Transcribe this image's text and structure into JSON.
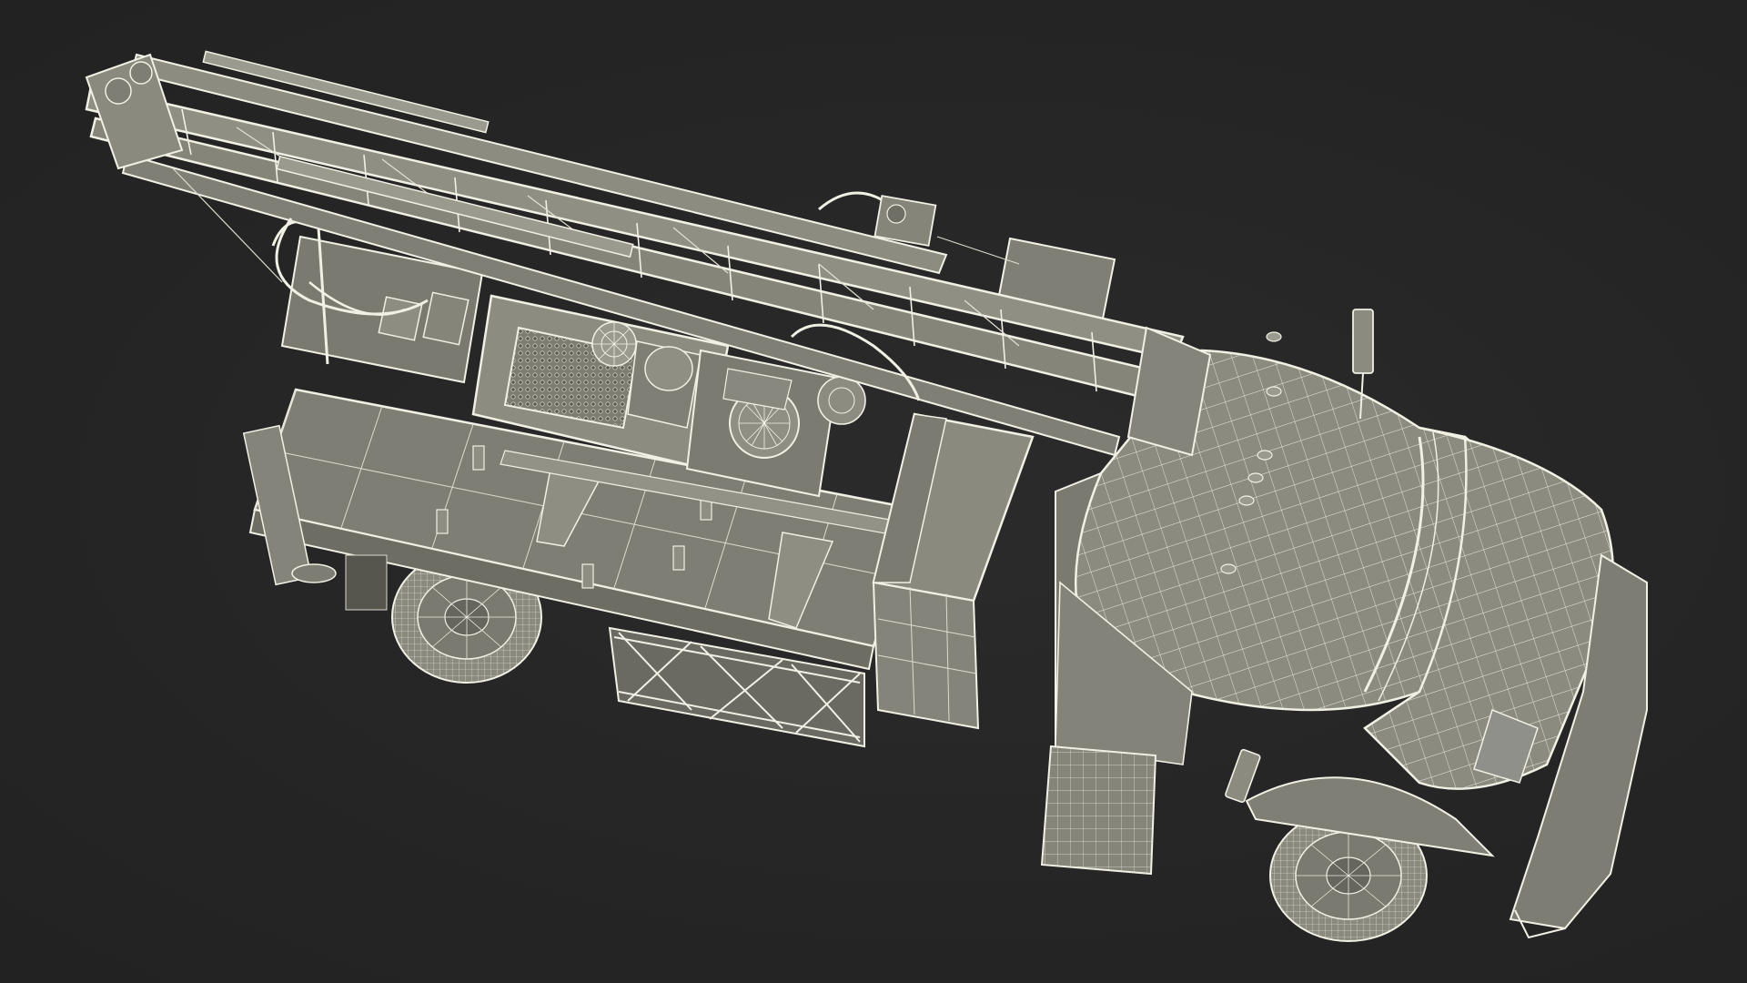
{
  "scene": {
    "subject": "drilling-rig-truck-wireframe",
    "colors": {
      "background": "#262626",
      "surface": "#8c8c80",
      "surface_dark": "#6f6f66",
      "wire": "#e9e9dc",
      "wire_dim": "#cfcfc2"
    }
  }
}
